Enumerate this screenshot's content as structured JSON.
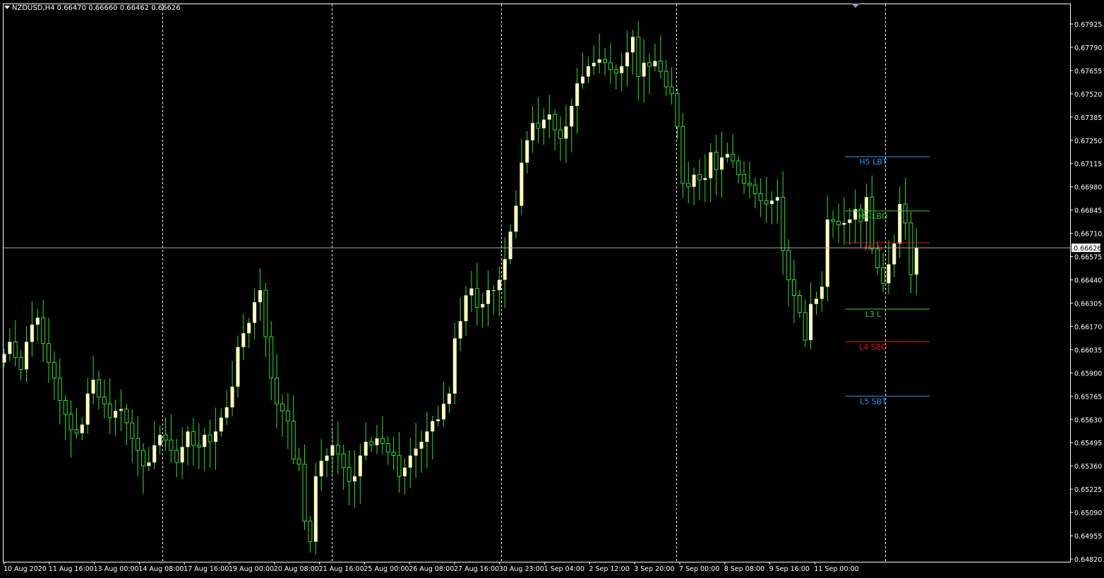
{
  "header": {
    "symbol": "NZDUSD,H4",
    "ohlc": "0.66470 0.66660 0.66462 0.66626"
  },
  "colors": {
    "background": "#000000",
    "frame": "#ffffff",
    "candle_up_body": "#ffffc0",
    "candle_wick": "#33dd33",
    "grid": "#ffffff",
    "crosshair": "#aaaaaa"
  },
  "chart_data": {
    "type": "candlestick",
    "title": "NZDUSD,H4",
    "grid": true,
    "ylim": [
      0.6482,
      0.68
    ],
    "price_ticks": [
      "0.67925",
      "0.67790",
      "0.67655",
      "0.67520",
      "0.67385",
      "0.67250",
      "0.67115",
      "0.66980",
      "0.66845",
      "0.66710",
      "0.66575",
      "0.66440",
      "0.66305",
      "0.66170",
      "0.66035",
      "0.65900",
      "0.65765",
      "0.65630",
      "0.65495",
      "0.65360",
      "0.65225",
      "0.65090",
      "0.64955",
      "0.64820"
    ],
    "time_ticks": [
      "10 Aug 2020",
      "11 Aug 16:00",
      "13 Aug 00:00",
      "14 Aug 08:00",
      "17 Aug 16:00",
      "19 Aug 00:00",
      "20 Aug 08:00",
      "21 Aug 16:00",
      "25 Aug 00:00",
      "26 Aug 08:00",
      "27 Aug 16:00",
      "30 Aug 23:00",
      "1 Sep 04:00",
      "2 Sep 12:00",
      "3 Sep 20:00",
      "7 Sep 00:00",
      "8 Sep 08:00",
      "9 Sep 16:00",
      "11 Sep 00:00"
    ],
    "current_price": "0.66626",
    "levels": [
      {
        "label": "H5 LBT",
        "price": 0.67155,
        "color": "#3399ee"
      },
      {
        "label": "H4 LBO",
        "price": 0.6684,
        "color": "#33cc33"
      },
      {
        "label": "H3 S",
        "price": 0.66655,
        "color": "#dd2222"
      },
      {
        "label": "L3 L",
        "price": 0.6627,
        "color": "#33cc33"
      },
      {
        "label": "L4 SBO",
        "price": 0.6608,
        "color": "#dd2222"
      },
      {
        "label": "L5 SBT",
        "price": 0.65765,
        "color": "#3399ee"
      }
    ],
    "close": [
      0.6601,
      0.6608,
      0.6599,
      0.6592,
      0.6608,
      0.6618,
      0.6622,
      0.6607,
      0.6596,
      0.6587,
      0.6574,
      0.6566,
      0.6557,
      0.6555,
      0.656,
      0.6578,
      0.6586,
      0.6576,
      0.6572,
      0.6564,
      0.6568,
      0.6569,
      0.6561,
      0.6552,
      0.6545,
      0.6536,
      0.6538,
      0.6548,
      0.6554,
      0.6551,
      0.6545,
      0.6538,
      0.6547,
      0.6556,
      0.6548,
      0.6547,
      0.6554,
      0.655,
      0.6556,
      0.6564,
      0.657,
      0.6582,
      0.6605,
      0.6613,
      0.6619,
      0.6631,
      0.6638,
      0.6611,
      0.6587,
      0.6572,
      0.6568,
      0.6562,
      0.654,
      0.6537,
      0.6504,
      0.6492,
      0.653,
      0.6539,
      0.6542,
      0.6548,
      0.6543,
      0.6535,
      0.6527,
      0.653,
      0.6542,
      0.655,
      0.6548,
      0.6552,
      0.6549,
      0.6544,
      0.6542,
      0.653,
      0.6535,
      0.6542,
      0.6546,
      0.655,
      0.6556,
      0.6562,
      0.6563,
      0.6572,
      0.6578,
      0.661,
      0.662,
      0.6635,
      0.6639,
      0.6628,
      0.663,
      0.6638,
      0.6638,
      0.6644,
      0.6656,
      0.6672,
      0.6687,
      0.6712,
      0.6725,
      0.6735,
      0.6732,
      0.6737,
      0.674,
      0.6731,
      0.6726,
      0.6733,
      0.6745,
      0.6758,
      0.6762,
      0.6768,
      0.677,
      0.6772,
      0.677,
      0.6766,
      0.6764,
      0.6768,
      0.6776,
      0.6785,
      0.6762,
      0.677,
      0.6768,
      0.6771,
      0.6765,
      0.6756,
      0.6752,
      0.6733,
      0.67,
      0.6698,
      0.6705,
      0.6702,
      0.6703,
      0.6718,
      0.6708,
      0.6715,
      0.6717,
      0.6713,
      0.6705,
      0.67,
      0.6699,
      0.6694,
      0.669,
      0.6688,
      0.669,
      0.6692,
      0.6661,
      0.6644,
      0.6635,
      0.6625,
      0.6609,
      0.663,
      0.6633,
      0.664,
      0.6679,
      0.6678,
      0.6676,
      0.6677,
      0.6679,
      0.6685,
      0.6678,
      0.6692,
      0.6662,
      0.6651,
      0.6642,
      0.6653,
      0.6665,
      0.6688,
      0.6677,
      0.6647,
      0.66626
    ],
    "bar_count": 153
  }
}
